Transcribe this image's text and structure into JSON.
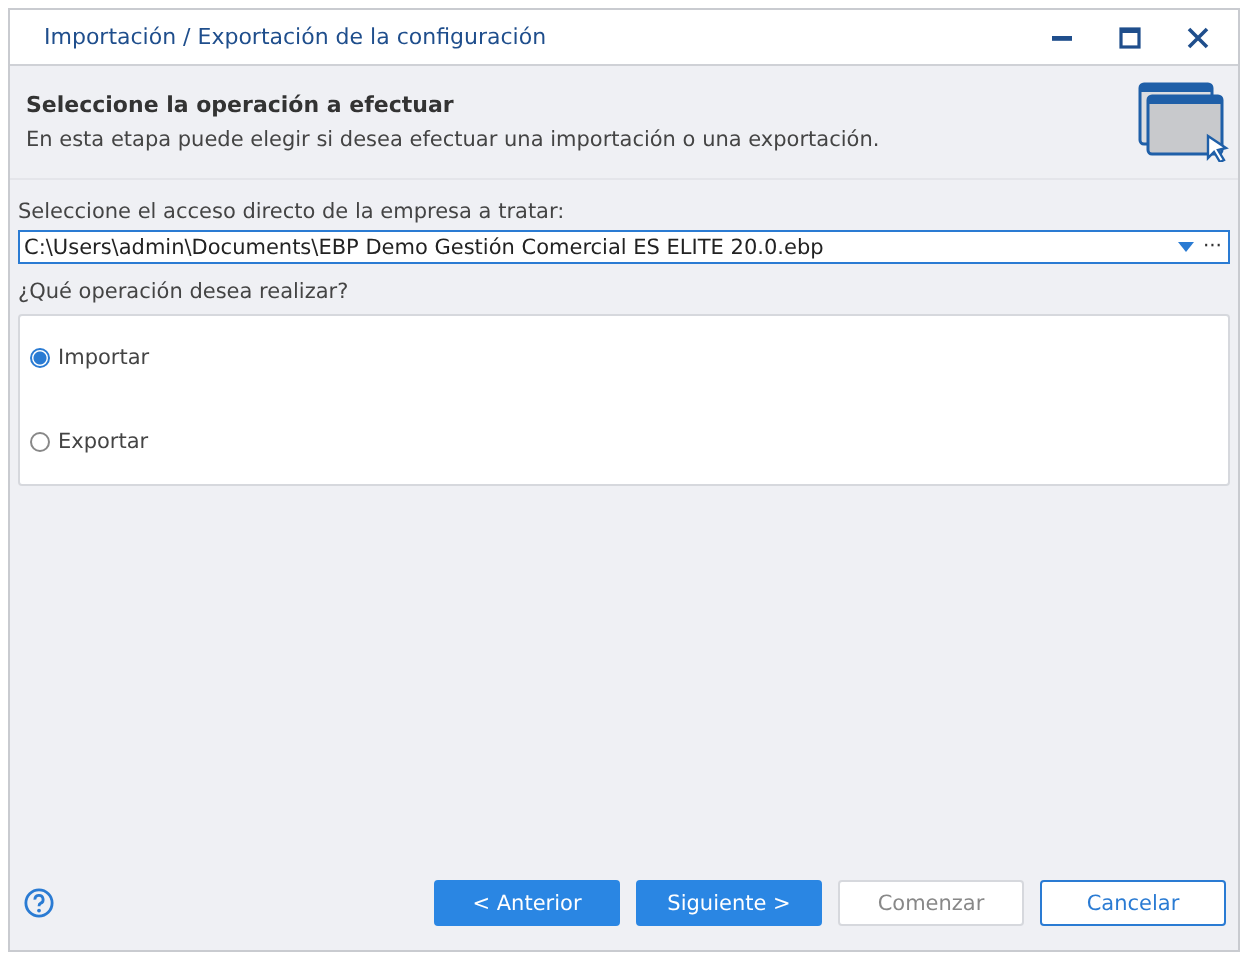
{
  "window": {
    "title": "Importación / Exportación de la configuración"
  },
  "header": {
    "title": "Seleccione la operación a efectuar",
    "description": "En esta etapa puede elegir si desea efectuar una importación o una exportación."
  },
  "shortcut": {
    "label": "Seleccione el acceso directo de la empresa a tratar:",
    "value": "C:\\Users\\admin\\Documents\\EBP Demo Gestión Comercial ES ELITE 20.0.ebp",
    "browse": "···"
  },
  "operation": {
    "label": "¿Qué operación desea realizar?",
    "options": [
      {
        "label": "Importar",
        "selected": true
      },
      {
        "label": "Exportar",
        "selected": false
      }
    ]
  },
  "buttons": [
    {
      "label": "< Anterior",
      "kind": "primary"
    },
    {
      "label": "Siguiente >",
      "kind": "primary"
    },
    {
      "label": "Comenzar",
      "kind": "disabled"
    },
    {
      "label": "Cancelar",
      "kind": "outline"
    }
  ]
}
